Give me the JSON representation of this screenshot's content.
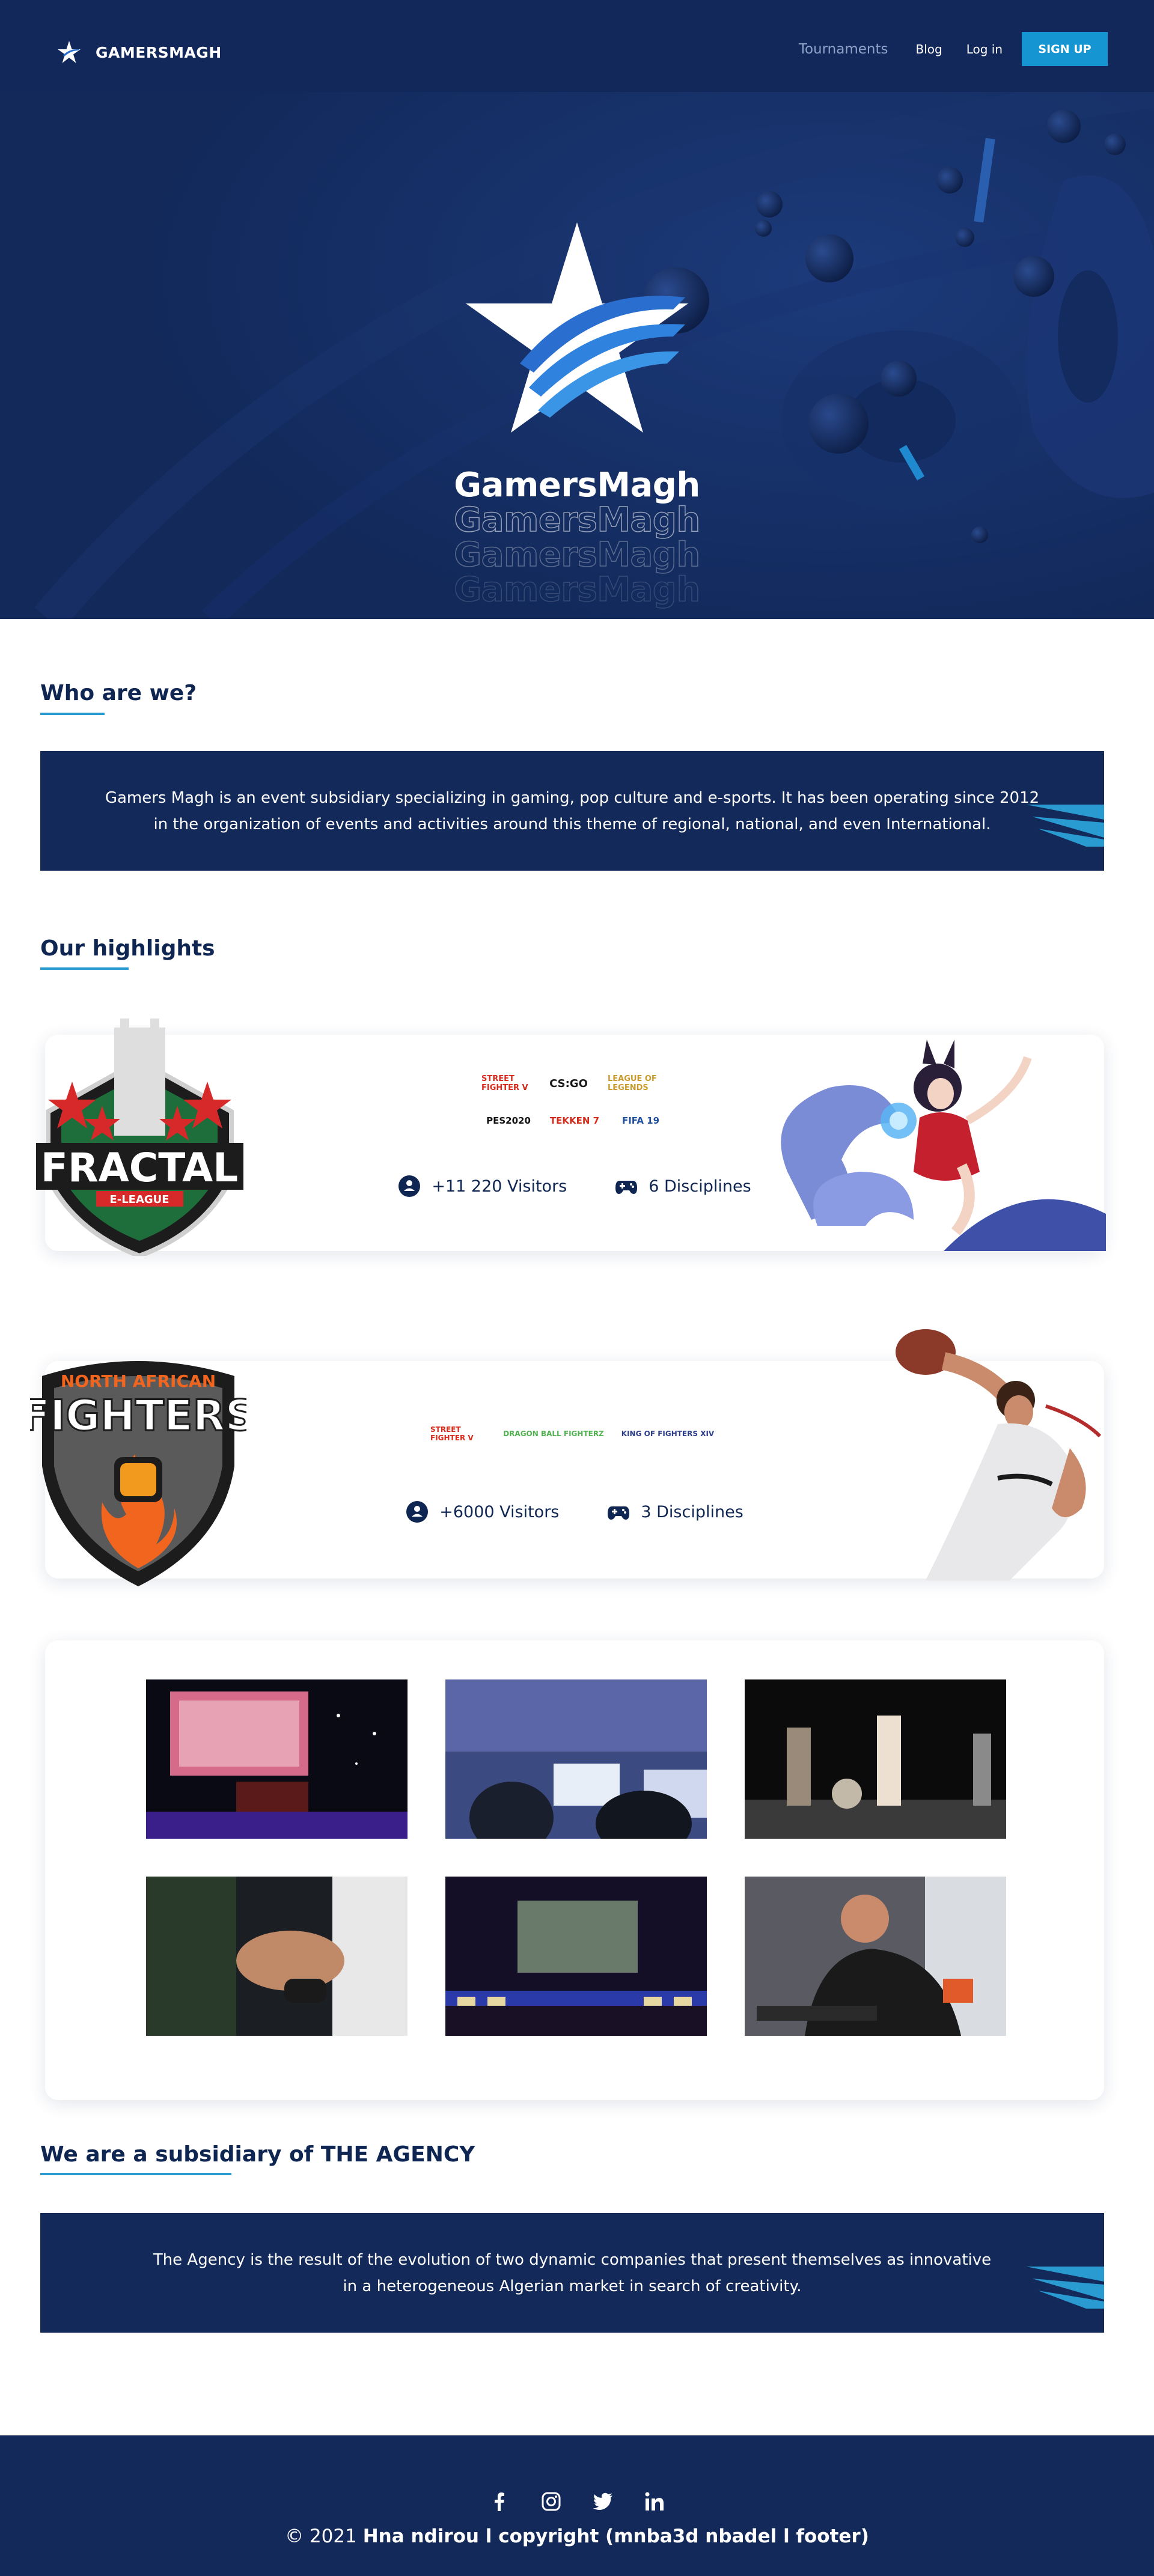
{
  "nav": {
    "brand": "GAMERSMAGH",
    "links": [
      "Tournaments",
      "Blog",
      "Log in"
    ],
    "signup": "SIGN UP"
  },
  "hero": {
    "title": "GamersMagh"
  },
  "about": {
    "title": "Who are we?",
    "text": "Gamers Magh is an event subsidiary specializing in gaming, pop culture and e-sports. It has been operating since 2012 in the organization of events and activities around this theme of regional, national, and even International."
  },
  "highlights": {
    "title": "Our highlights",
    "events": [
      {
        "logo_text": "FRACTAL",
        "logo_sub": "E-LEAGUE",
        "games": [
          "STREET FIGHTER V",
          "CS:GO",
          "LEAGUE OF LEGENDS",
          "PES2020",
          "TEKKEN 7",
          "FIFA 19"
        ],
        "visitors": "+11 220 Visitors",
        "disciplines": "6 Disciplines"
      },
      {
        "logo_top": "NORTH AFRICAN",
        "logo_text": "FIGHTERS",
        "games": [
          "STREET FIGHTER V",
          "DRAGON BALL FIGHTERZ",
          "KING OF FIGHTERS XIV"
        ],
        "visitors": "+6000 Visitors",
        "disciplines": "3 Disciplines"
      }
    ]
  },
  "agency": {
    "title": "We are a subsidiary of THE AGENCY",
    "text": "The Agency is the result of the evolution of two dynamic companies that present themselves as innovative in a heterogeneous Algerian market in search of creativity."
  },
  "footer": {
    "copyright_prefix": "© 2021 ",
    "copyright_bold": "Hna ndirou l copyright (mnba3d nbadel l footer)"
  },
  "colors": {
    "navy": "#12295a",
    "accent": "#1596d2",
    "white": "#ffffff"
  }
}
